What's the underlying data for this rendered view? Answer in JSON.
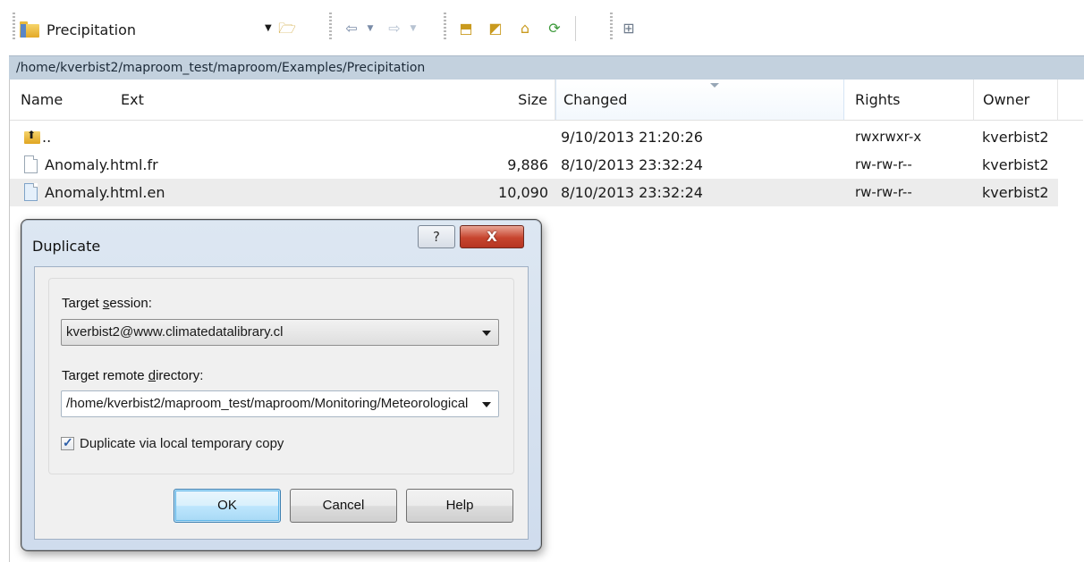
{
  "toolbar": {
    "current_folder": "Precipitation",
    "icons": [
      "folder-open-icon",
      "back-arrow-icon",
      "forward-arrow-icon",
      "parent-dir-icon",
      "root-dir-icon",
      "home-icon",
      "refresh-icon",
      "tree-icon"
    ]
  },
  "address": "/home/kverbist2/maproom_test/maproom/Examples/Precipitation",
  "columns": {
    "name": "Name",
    "ext": "Ext",
    "size": "Size",
    "changed": "Changed",
    "rights": "Rights",
    "owner": "Owner"
  },
  "files": [
    {
      "name": "..",
      "size": "",
      "changed": "9/10/2013 21:20:26",
      "rights": "rwxrwxr-x",
      "owner": "kverbist2"
    },
    {
      "name": "Anomaly.html.fr",
      "size": "9,886",
      "changed": "8/10/2013 23:32:24",
      "rights": "rw-rw-r--",
      "owner": "kverbist2"
    },
    {
      "name": "Anomaly.html.en",
      "size": "10,090",
      "changed": "8/10/2013 23:32:24",
      "rights": "rw-rw-r--",
      "owner": "kverbist2"
    }
  ],
  "dialog": {
    "title": "Duplicate",
    "help_glyph": "?",
    "close_glyph": "X",
    "session_label_pre": "Target ",
    "session_label_key": "s",
    "session_label_post": "ession:",
    "session_value": "kverbist2@www.climatedatalibrary.cl",
    "dir_label_pre": "Target remote ",
    "dir_label_key": "d",
    "dir_label_post": "irectory:",
    "dir_value": "/home/kverbist2/maproom_test/maproom/Monitoring/Meteorological",
    "checkbox_label": "Duplicate via local temporary copy",
    "checkbox_checked": true,
    "ok": "OK",
    "cancel": "Cancel",
    "help": "Help"
  }
}
